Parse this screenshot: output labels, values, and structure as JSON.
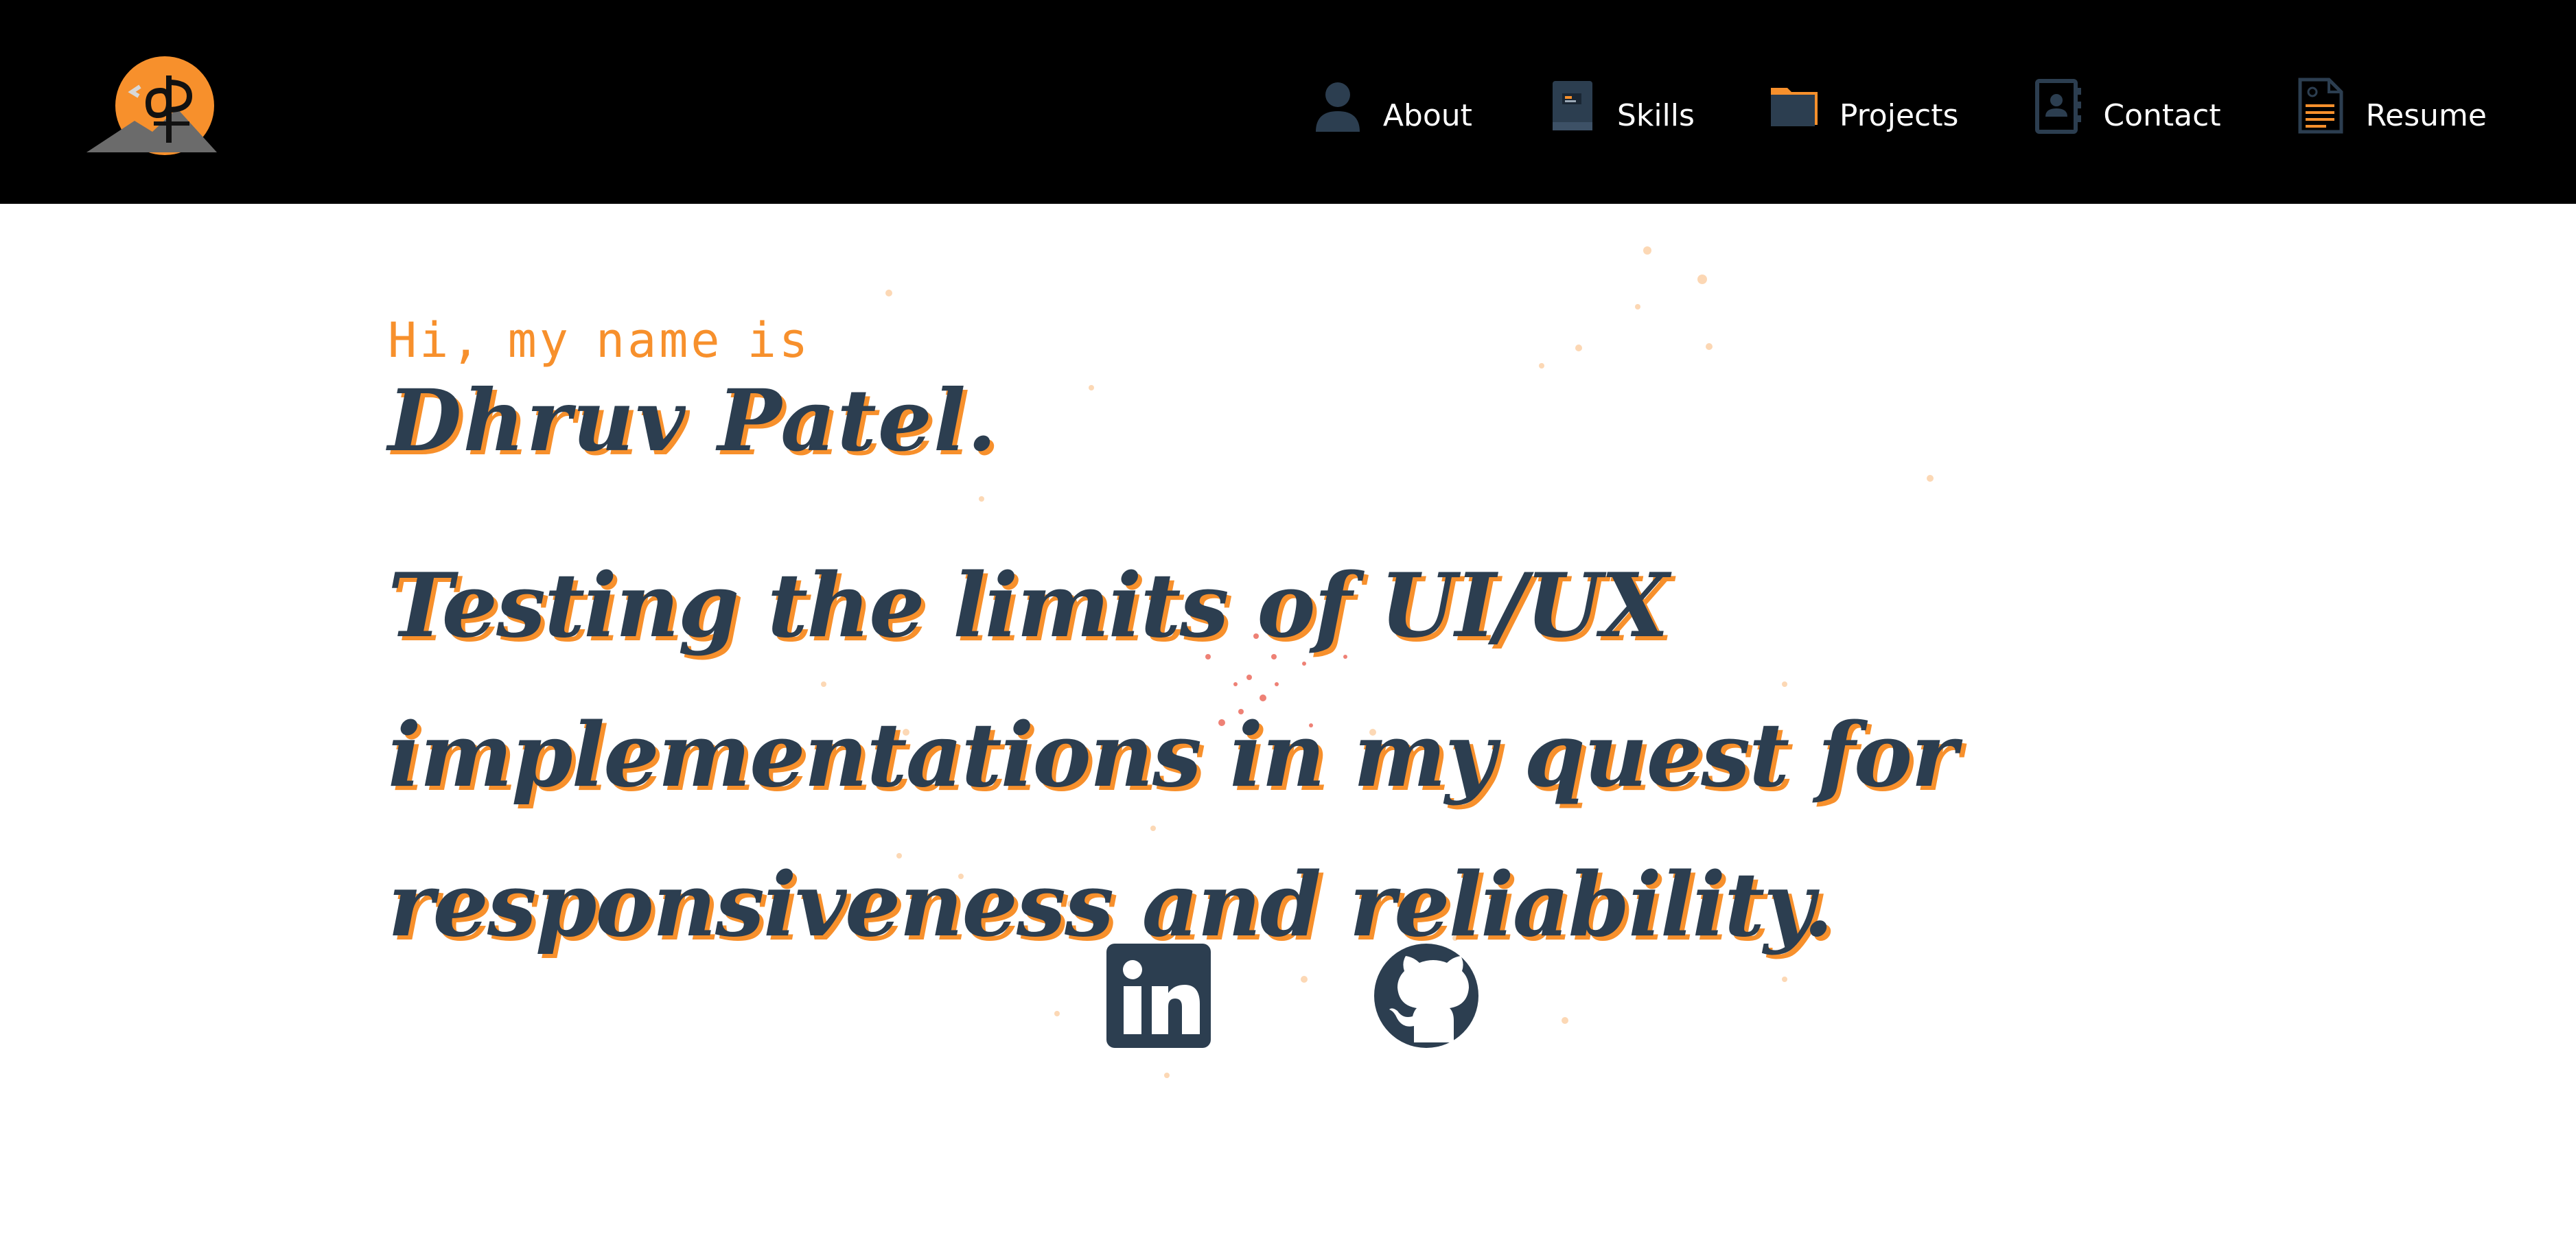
{
  "colors": {
    "navbar_bg": "#000000",
    "accent": "#f7902c",
    "text_dark": "#2c3e50",
    "page_bg": "#ffffff"
  },
  "header": {
    "logo_icon": "dp-monogram-mountain-sun-logo",
    "nav": [
      {
        "label": "About",
        "icon": "person-icon"
      },
      {
        "label": "Skills",
        "icon": "book-icon"
      },
      {
        "label": "Projects",
        "icon": "folder-icon"
      },
      {
        "label": "Contact",
        "icon": "contact-card-icon"
      },
      {
        "label": "Resume",
        "icon": "document-icon"
      }
    ]
  },
  "hero": {
    "greeting": "Hi, my name is",
    "name": "Dhruv Patel.",
    "tagline": "Testing the limits of UI/UX implementations in my quest for responsiveness and reliability."
  },
  "socials": [
    {
      "icon": "linkedin-icon"
    },
    {
      "icon": "github-icon"
    }
  ]
}
